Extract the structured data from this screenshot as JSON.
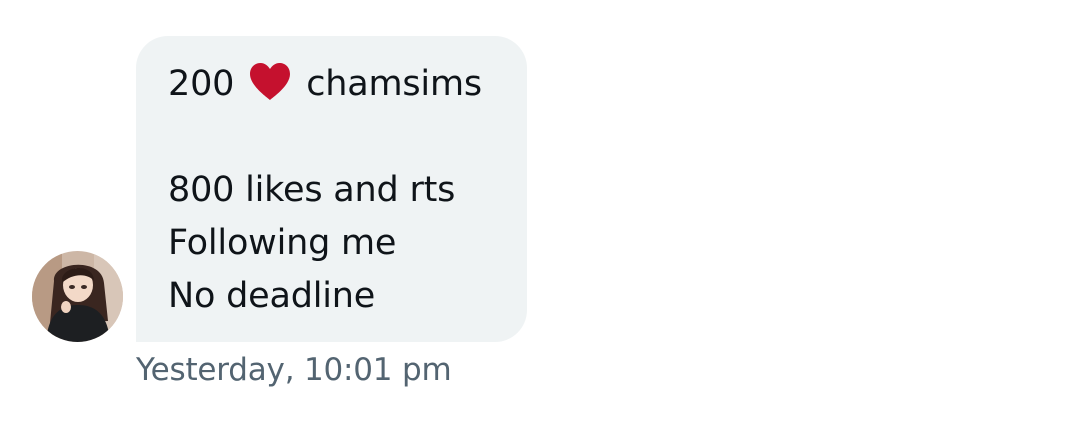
{
  "message": {
    "line1_prefix": "200",
    "line1_icon": "heart-icon",
    "line1_suffix": "chamsims",
    "line2": "800 likes and rts",
    "line3": "Following me",
    "line4": "No deadline"
  },
  "timestamp": "Yesterday, 10:01 pm",
  "colors": {
    "bubble_bg": "#eff3f4",
    "text": "#0f1419",
    "timestamp": "#536471",
    "heart": "#c5112e"
  }
}
